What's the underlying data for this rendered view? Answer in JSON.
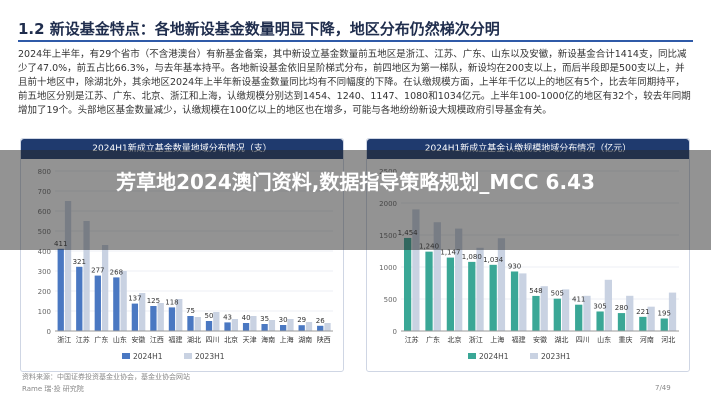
{
  "header": {
    "title": "1.2 新设基金特点：各地新设基金数量明显下降，地区分布仍然梯次分明",
    "paragraph": "2024年上半年，有29个省市（不含港澳台）有新基金备案，其中新设立基金数量前五地区是浙江、江苏、广东、山东以及安徽，新设基金合计1414支，同比减少了47.0%，前五占比66.3%，与去年基本持平。各地新设基金依旧呈阶梯式分布，前四地区为第一梯队，新设均在200支以上，而后半段即是500支以上，并且前十地区中，除湖北外，其余地区2024年上半年新设基金数量同比均有不同幅度的下降。在认缴规模方面，上半年千亿以上的地区有5个，比去年同期持平，前五地区分别是江苏、广东、北京、浙江和上海，认缴规模分别达到1454、1240、1147、1080和1034亿元。上半年100-1000亿的地区有32个，较去年同期增加了19个。头部地区基金数量减少，认缴规模在100亿以上的地区也在增多，可能与各地纷纷新设大规模政府引导基金有关。"
  },
  "overlay": {
    "text": "芳草地2024澳门资料,数据指导策略规划_MCC 6.43"
  },
  "footer": {
    "source": "资料来源：中国证券投资基金业协会，基金业协会网站",
    "brand": "Rame 瑞·投 研究院",
    "page": "7/49"
  },
  "chart_data": [
    {
      "type": "bar",
      "title": "2024H1新成立基金数量地域分布情况（支）",
      "categories": [
        "浙江",
        "江苏",
        "广东",
        "山东",
        "安徽",
        "江西",
        "福建",
        "湖北",
        "四川",
        "北京",
        "天津",
        "海南",
        "上海",
        "湖南",
        "陕西"
      ],
      "series": [
        {
          "name": "2024H1",
          "values": [
            411,
            321,
            277,
            268,
            137,
            125,
            118,
            75,
            50,
            43,
            40,
            35,
            30,
            29,
            26
          ],
          "color": "#4a78c2"
        },
        {
          "name": "2023H1",
          "values": [
            650,
            550,
            430,
            300,
            190,
            140,
            160,
            70,
            95,
            60,
            75,
            55,
            60,
            45,
            40
          ],
          "color": "#c9d2e2"
        }
      ],
      "labels": [
        "411",
        "321",
        "277",
        "268",
        "137",
        "125",
        "118",
        "75",
        "50",
        "43",
        "40",
        "35",
        "30",
        "29",
        "26"
      ],
      "yticks": [
        0,
        100,
        200,
        300,
        400,
        500,
        600,
        700,
        800
      ],
      "ylim": [
        0,
        800
      ]
    },
    {
      "type": "bar",
      "title": "2024H1新成立基金认缴规模地域分布情况（亿元）",
      "categories": [
        "江苏",
        "广东",
        "北京",
        "浙江",
        "上海",
        "福建",
        "安徽",
        "湖北",
        "四川",
        "山东",
        "重庆",
        "河南",
        "河北"
      ],
      "series": [
        {
          "name": "2024H1",
          "values": [
            1454,
            1240,
            1147,
            1080,
            1034,
            930,
            548,
            505,
            411,
            305,
            280,
            221,
            195
          ],
          "color": "#3aa796"
        },
        {
          "name": "2023H1",
          "values": [
            1900,
            1700,
            1600,
            1300,
            1450,
            900,
            700,
            650,
            550,
            800,
            550,
            380,
            600
          ],
          "color": "#c9d2e2"
        }
      ],
      "labels": [
        "1,454",
        "1,240",
        "1,147",
        "1,080",
        "1,034",
        "930",
        "548",
        "505",
        "411",
        "305",
        "280",
        "221",
        "195"
      ],
      "yticks": [
        0,
        500,
        1000,
        1500,
        2000,
        2500
      ],
      "ylim": [
        0,
        2500
      ]
    }
  ]
}
